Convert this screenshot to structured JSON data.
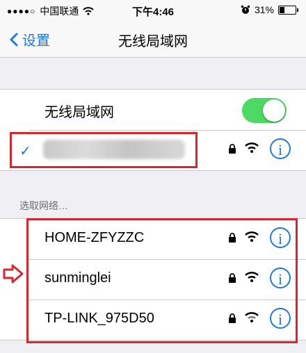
{
  "status_bar": {
    "signal": "●●●●○",
    "carrier": "中国联通",
    "time": "下午4:46",
    "battery": "31%",
    "battery_level": 0.31
  },
  "nav": {
    "back_label": "设置",
    "title": "无线局域网"
  },
  "wifi_toggle": {
    "label": "无线局域网",
    "on": true
  },
  "section_header": "选取网络…",
  "networks": [
    {
      "name": "HOME-ZFYZZC"
    },
    {
      "name": "sunminglei"
    },
    {
      "name": "TP-LINK_975D50"
    }
  ],
  "colors": {
    "accent": "#1a7ae0",
    "toggle_on": "#4cd964",
    "annotation": "#d9262c"
  }
}
